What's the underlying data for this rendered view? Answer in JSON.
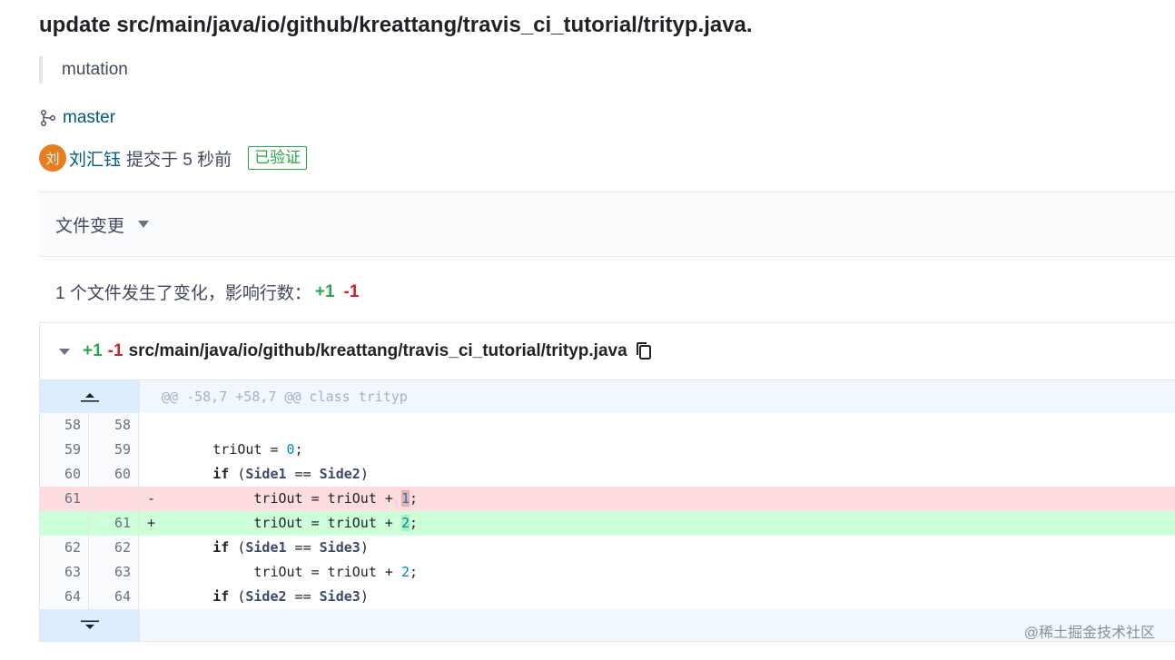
{
  "commit": {
    "title": "update src/main/java/io/github/kreattang/travis_ci_tutorial/trityp.java.",
    "message": "mutation",
    "branch": "master",
    "avatar_text": "刘",
    "author": "刘汇钰",
    "time_text": "提交于 5 秒前",
    "verified": "已验证"
  },
  "files": {
    "header_label": "文件变更",
    "summary_text": "1 个文件发生了变化，影响行数：",
    "summary_add": "+1",
    "summary_del": "-1"
  },
  "diff": {
    "add_count": "+1",
    "del_count": "-1",
    "path": "src/main/java/io/github/kreattang/travis_ci_tutorial/trityp.java",
    "hunk_header": "@@ -58,7 +58,7 @@ class trityp",
    "lines": [
      {
        "old": "58",
        "new": "58",
        "sign": "",
        "type": "ctx"
      },
      {
        "old": "59",
        "new": "59",
        "sign": "",
        "type": "ctx"
      },
      {
        "old": "60",
        "new": "60",
        "sign": "",
        "type": "ctx"
      },
      {
        "old": "61",
        "new": "",
        "sign": "-",
        "type": "del"
      },
      {
        "old": "",
        "new": "61",
        "sign": "+",
        "type": "add"
      },
      {
        "old": "62",
        "new": "62",
        "sign": "",
        "type": "ctx"
      },
      {
        "old": "63",
        "new": "63",
        "sign": "",
        "type": "ctx"
      },
      {
        "old": "64",
        "new": "64",
        "sign": "",
        "type": "ctx"
      }
    ],
    "code_tokens": {
      "l59_a": "        triOut = ",
      "l59_num": "0",
      "l59_b": ";",
      "if": "if",
      "l60_a": " (",
      "side1": "Side1",
      "side2": "Side2",
      "side3": "Side3",
      "eq": " == ",
      "close": ")",
      "indent2": "        ",
      "inner_a": "            triOut = triOut + ",
      "del_num": "1",
      "add_num": "2",
      "semi": ";",
      "l63_num": "2"
    }
  },
  "watermark": "@稀土掘金技术社区"
}
